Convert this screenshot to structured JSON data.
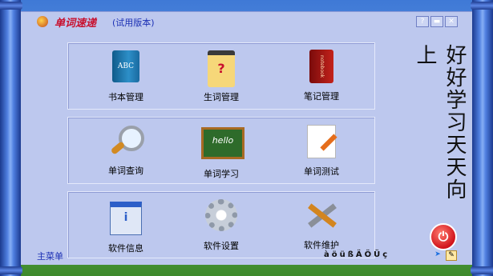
{
  "app": {
    "name": "单词速递",
    "edition": "(试用版本)"
  },
  "window_buttons": {
    "help": "?",
    "minimize": "▬",
    "close": "✕"
  },
  "panels": [
    {
      "items": [
        {
          "label": "书本管理",
          "icon": "book-icon",
          "glyph": "ABC"
        },
        {
          "label": "生词管理",
          "icon": "memo-icon",
          "glyph": "?"
        },
        {
          "label": "笔记管理",
          "icon": "notebook-icon",
          "glyph": "notebook"
        }
      ]
    },
    {
      "items": [
        {
          "label": "单词查询",
          "icon": "magnifier-icon"
        },
        {
          "label": "单词学习",
          "icon": "chalkboard-icon",
          "glyph": "hello"
        },
        {
          "label": "单词测试",
          "icon": "document-pen-icon"
        }
      ]
    },
    {
      "items": [
        {
          "label": "软件信息",
          "icon": "info-window-icon",
          "glyph": "i"
        },
        {
          "label": "软件设置",
          "icon": "gear-icon"
        },
        {
          "label": "软件维护",
          "icon": "tools-icon"
        }
      ]
    }
  ],
  "motto": "好好学习天天向上",
  "status": {
    "menu_label": "主菜单",
    "symbols": "àöüßÄÖÜç"
  },
  "colors": {
    "accent": "#1b2fb4",
    "brand_red": "#c8102e",
    "window_bg": "#bdc8ee"
  }
}
